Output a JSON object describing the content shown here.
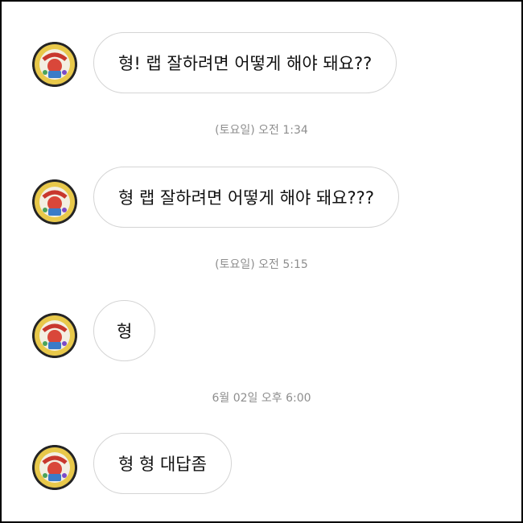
{
  "messages": [
    {
      "text": "형! 랩 잘하려면 어떻게 해야 돼요??"
    },
    {
      "text": "형 랩 잘하려면 어떻게 해야 돼요???"
    },
    {
      "text": "형"
    },
    {
      "text": "형 형 대답좀"
    }
  ],
  "timestamps": [
    "(토요일) 오전 1:34",
    "(토요일) 오전 5:15",
    "6월 02일 오후 6:00"
  ],
  "colors": {
    "bubble_border": "#d4d4d4",
    "timestamp_text": "#8e8e8e",
    "message_text": "#111111"
  }
}
